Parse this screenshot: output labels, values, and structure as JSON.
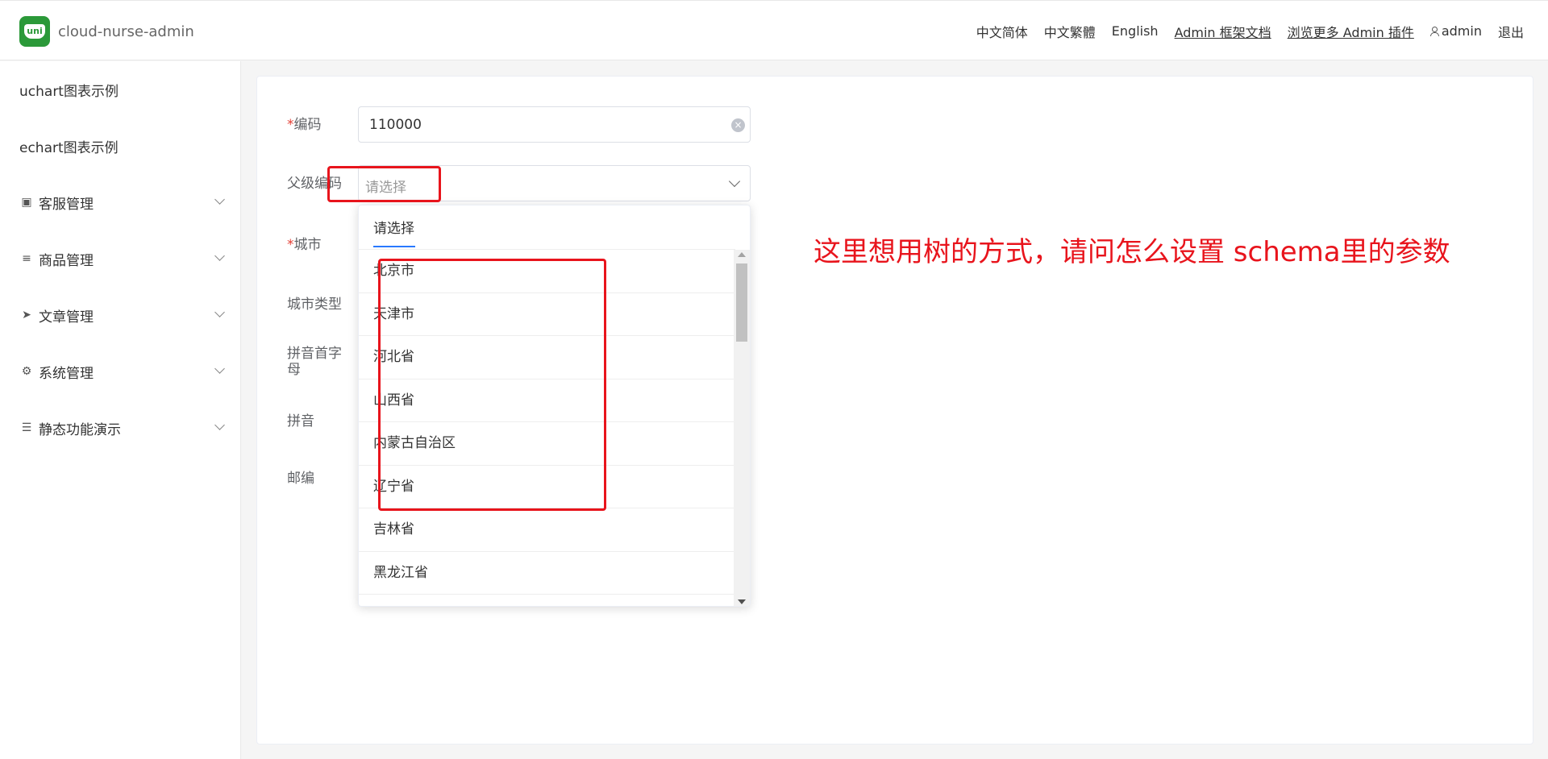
{
  "app": {
    "logo_text": "uni",
    "name": "cloud-nurse-admin"
  },
  "navbar": {
    "items": [
      "中文简体",
      "中文繁體",
      "English",
      "Admin 框架文档",
      "浏览更多 Admin 插件"
    ],
    "user": "admin",
    "logout": "退出"
  },
  "sidebar": {
    "items": [
      {
        "label": "uchart图表示例"
      },
      {
        "label": "echart图表示例"
      },
      {
        "label": "客服管理",
        "icon": "image-icon"
      },
      {
        "label": "商品管理",
        "icon": "sliders-icon"
      },
      {
        "label": "文章管理",
        "icon": "send-icon"
      },
      {
        "label": "系统管理",
        "icon": "gear-icon"
      },
      {
        "label": "静态功能演示",
        "icon": "list-icon"
      }
    ]
  },
  "form": {
    "required_mark": "*",
    "code_label": "编码",
    "code_value": "110000",
    "parent_label": "父级编码",
    "parent_placeholder": "请选择",
    "city_label": "城市",
    "city_type_label": "城市类型",
    "pinyin_initial_label": "拼音首字母",
    "pinyin_label": "拼音",
    "zip_label": "邮编"
  },
  "dropdown": {
    "header": "请选择",
    "options": [
      "北京市",
      "天津市",
      "河北省",
      "山西省",
      "内蒙古自治区",
      "辽宁省",
      "吉林省",
      "黑龙江省"
    ]
  },
  "annotation": {
    "text": "这里想用树的方式，请问怎么设置 schema里的参数",
    "color": "#e8141c"
  }
}
